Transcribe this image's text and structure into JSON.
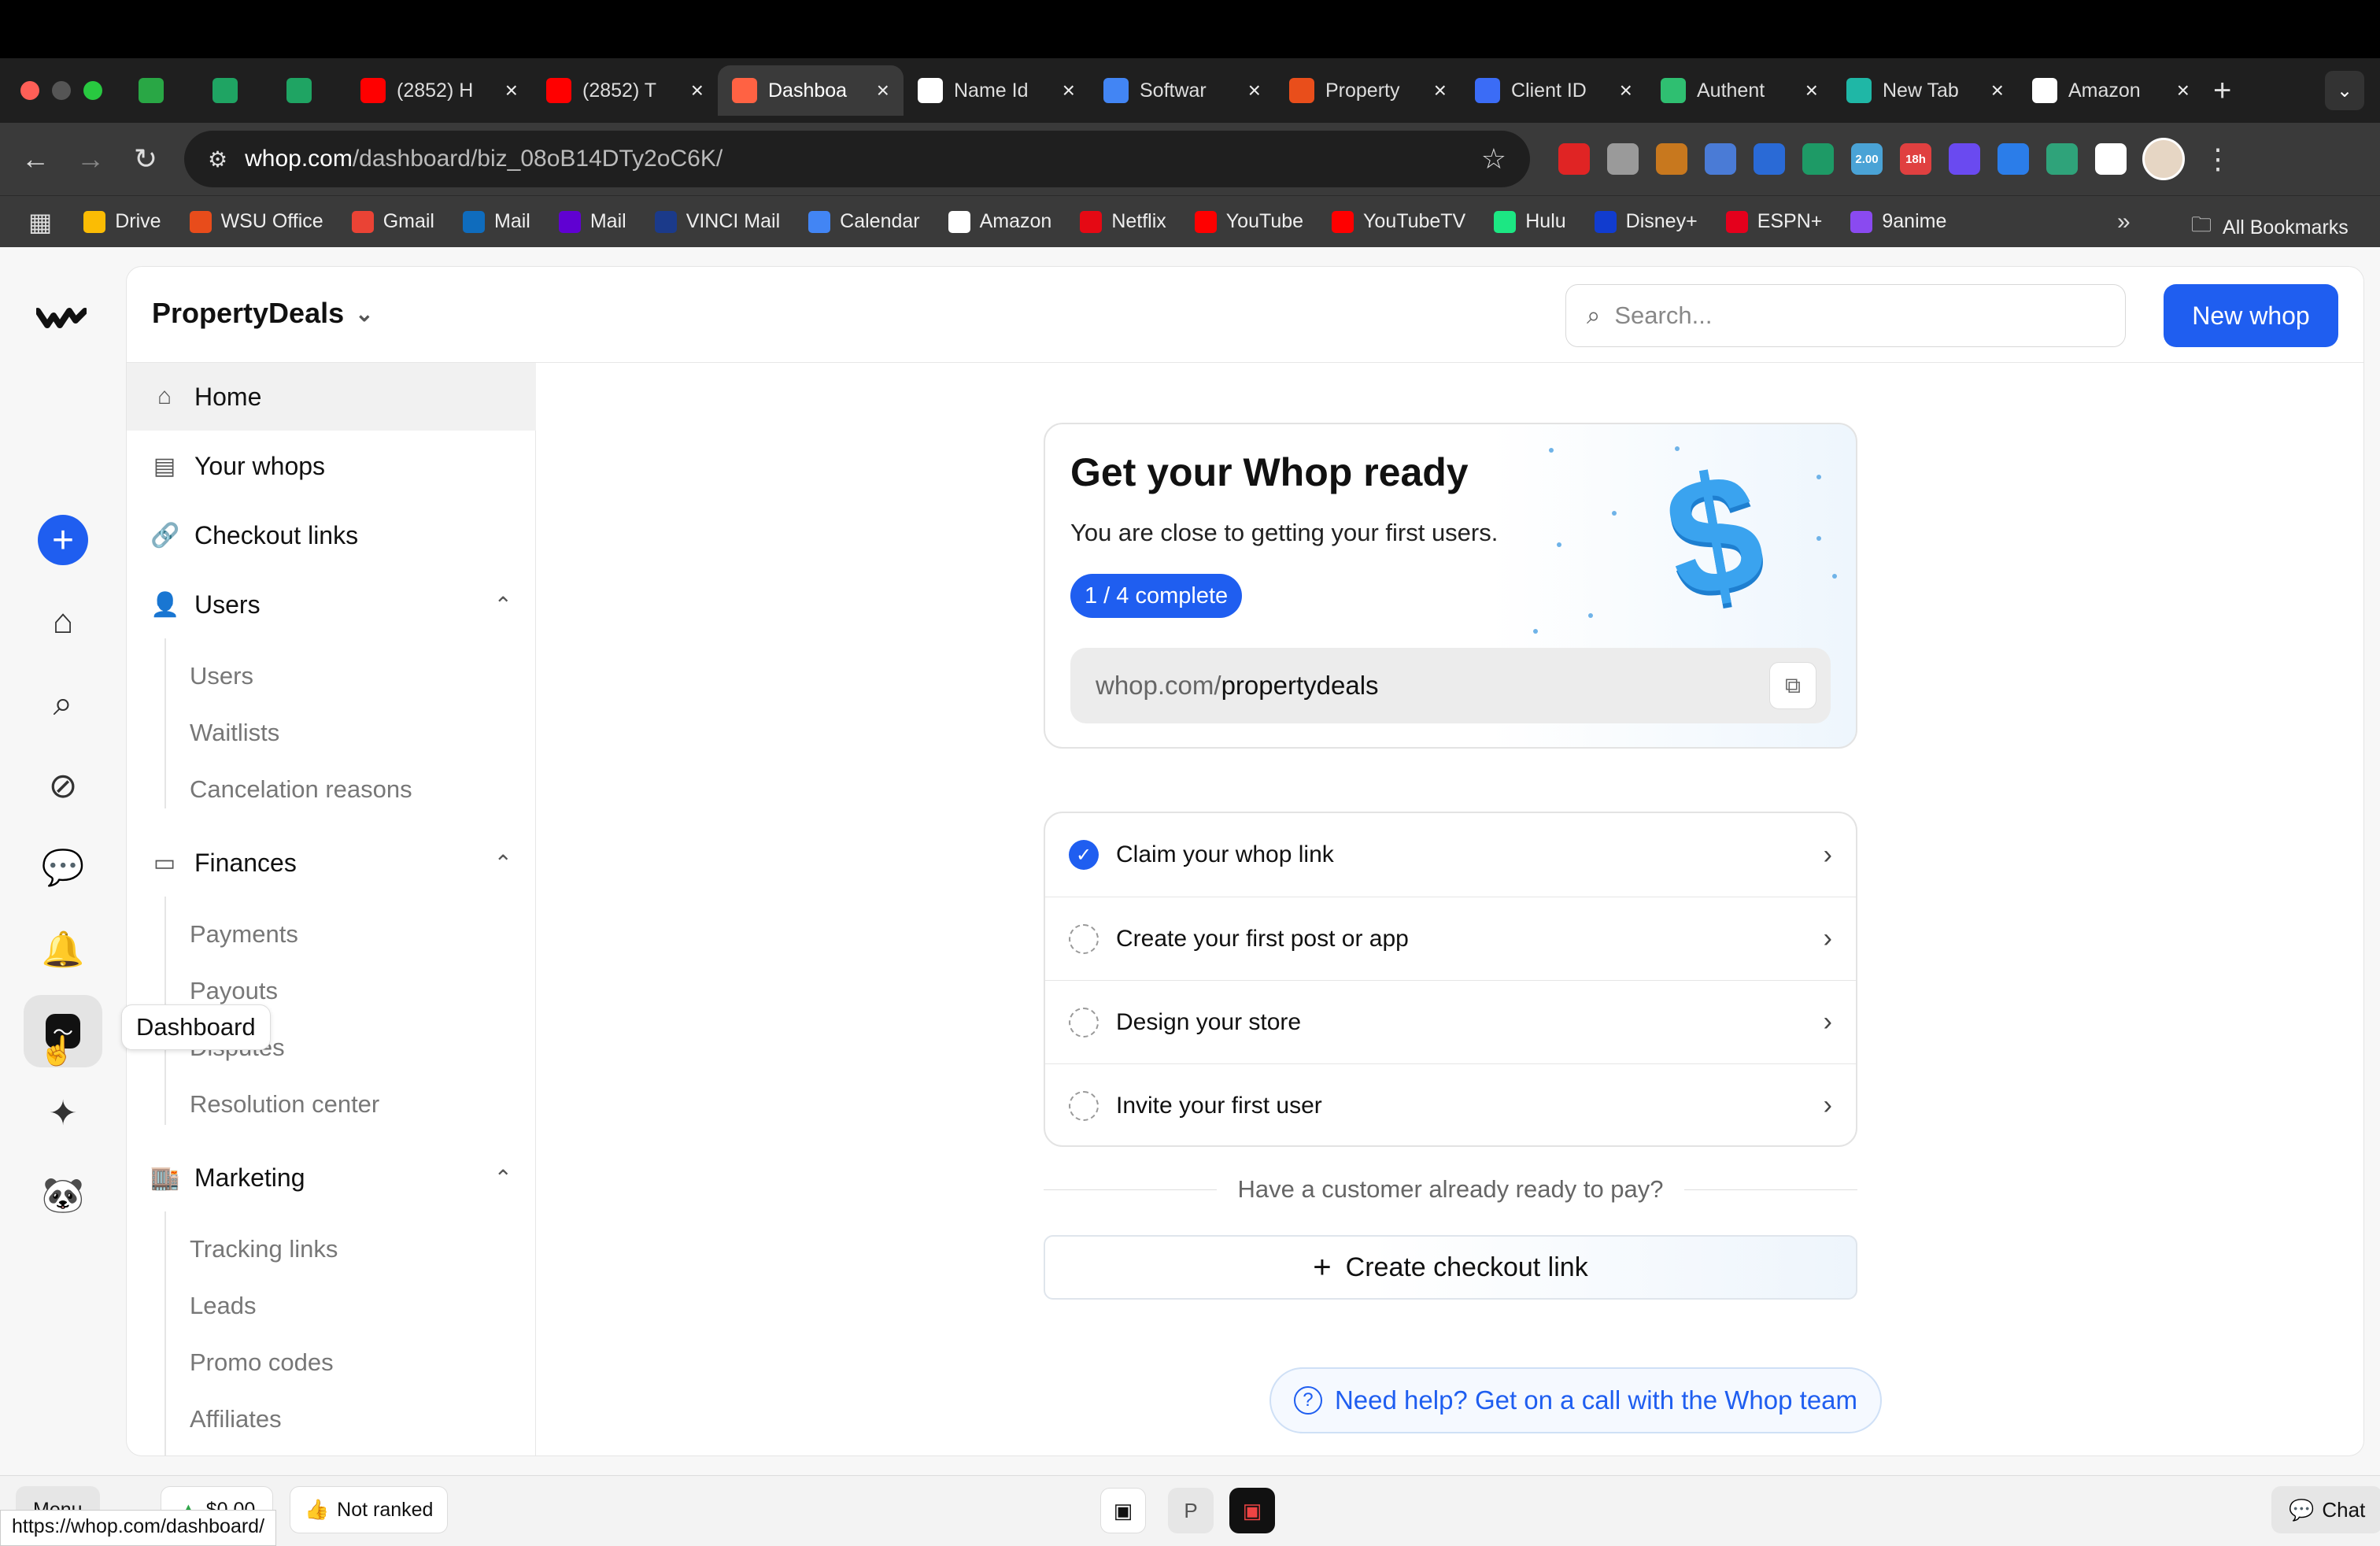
{
  "browser": {
    "tabs": [
      {
        "label": "",
        "icon": "p-icon",
        "color": "#29a745",
        "active": false,
        "small": true
      },
      {
        "label": "",
        "icon": "sheets-icon",
        "color": "#1fa463",
        "active": false,
        "small": true
      },
      {
        "label": "",
        "icon": "sheets-icon",
        "color": "#1fa463",
        "active": false,
        "small": true
      },
      {
        "label": "(2852) H",
        "icon": "youtube-icon",
        "color": "#ff0000",
        "active": false,
        "small": false
      },
      {
        "label": "(2852) T",
        "icon": "youtube-icon",
        "color": "#ff0000",
        "active": false,
        "small": false
      },
      {
        "label": "Dashboa",
        "icon": "whop-icon",
        "color": "#ff6243",
        "active": true,
        "small": false
      },
      {
        "label": "Name Id",
        "icon": "openai-icon",
        "color": "#ffffff",
        "active": false,
        "small": false
      },
      {
        "label": "Softwar",
        "icon": "docs-icon",
        "color": "#4285f4",
        "active": false,
        "small": false
      },
      {
        "label": "Property",
        "icon": "grid-icon",
        "color": "#e94e1b",
        "active": false,
        "small": false
      },
      {
        "label": "Client ID",
        "icon": "shield-icon",
        "color": "#3b6cf6",
        "active": false,
        "small": false
      },
      {
        "label": "Authent",
        "icon": "bolt-icon",
        "color": "#2fbf71",
        "active": false,
        "small": false
      },
      {
        "label": "New Tab",
        "icon": "m-icon",
        "color": "#1fb7a6",
        "active": false,
        "small": false
      },
      {
        "label": "Amazon",
        "icon": "amazon-icon",
        "color": "#ffffff",
        "active": false,
        "small": false
      }
    ],
    "url_host": "whop.com",
    "url_path": "/dashboard/biz_08oB14DTy2oC6K/",
    "extensions": [
      "#e02424",
      "#9a9a9a",
      "#c8781e",
      "#4a7bd6",
      "#2a6ad6",
      "#1e9a66",
      "#4aa3d6",
      "#e04040",
      "#6a4af0",
      "#2b7de9",
      "#2fa37a",
      "#ffffff"
    ],
    "ext_badges": {
      "ext6": "2.00",
      "ext7": "18h"
    },
    "bookmarks": [
      {
        "label": "Drive",
        "color": "#fbbc04"
      },
      {
        "label": "WSU Office",
        "color": "#e84c1b"
      },
      {
        "label": "Gmail",
        "color": "#ea4335"
      },
      {
        "label": "Mail",
        "color": "#0f6cbd"
      },
      {
        "label": "Mail",
        "color": "#6001d2"
      },
      {
        "label": "VINCI Mail",
        "color": "#1b3a8a"
      },
      {
        "label": "Calendar",
        "color": "#4285f4"
      },
      {
        "label": "Amazon",
        "color": "#ffffff"
      },
      {
        "label": "Netflix",
        "color": "#e50914"
      },
      {
        "label": "YouTube",
        "color": "#ff0000"
      },
      {
        "label": "YouTubeTV",
        "color": "#ff0000"
      },
      {
        "label": "Hulu",
        "color": "#1ce783"
      },
      {
        "label": "Disney+",
        "color": "#113ccf"
      },
      {
        "label": "ESPN+",
        "color": "#e5001c"
      },
      {
        "label": "9anime",
        "color": "#8a4af0"
      }
    ],
    "all_bookmarks": "All Bookmarks"
  },
  "header": {
    "business": "PropertyDeals",
    "search_placeholder": "Search...",
    "new_whop": "New whop"
  },
  "rail": {
    "tooltip": "Dashboard"
  },
  "sidebar": {
    "home": "Home",
    "your_whops": "Your whops",
    "checkout_links": "Checkout links",
    "users": {
      "label": "Users",
      "items": [
        "Users",
        "Waitlists",
        "Cancelation reasons"
      ]
    },
    "finances": {
      "label": "Finances",
      "items": [
        "Payments",
        "Payouts",
        "Disputes",
        "Resolution center"
      ]
    },
    "marketing": {
      "label": "Marketing",
      "items": [
        "Tracking links",
        "Leads",
        "Promo codes",
        "Affiliates"
      ]
    }
  },
  "ready_card": {
    "title": "Get your Whop ready",
    "subtitle": "You are close to getting your first users.",
    "progress": "1 / 4 complete",
    "progress_fraction": 0.25,
    "link_prefix": "whop.com/",
    "link_slug": "propertydeals"
  },
  "tasks": [
    {
      "label": "Claim your whop link",
      "done": true
    },
    {
      "label": "Create your first post or app",
      "done": false
    },
    {
      "label": "Design your store",
      "done": false
    },
    {
      "label": "Invite your first user",
      "done": false
    }
  ],
  "cta": {
    "divider_text": "Have a customer already ready to pay?",
    "create_checkout": "Create checkout link",
    "help": "Need help? Get on a call with the Whop team"
  },
  "dock": {
    "menu": "Menu",
    "money": "$0.00",
    "rank": "Not ranked",
    "chat": "Chat",
    "status_url": "https://whop.com/dashboard/"
  },
  "colors": {
    "accent": "#1f5ef0"
  }
}
